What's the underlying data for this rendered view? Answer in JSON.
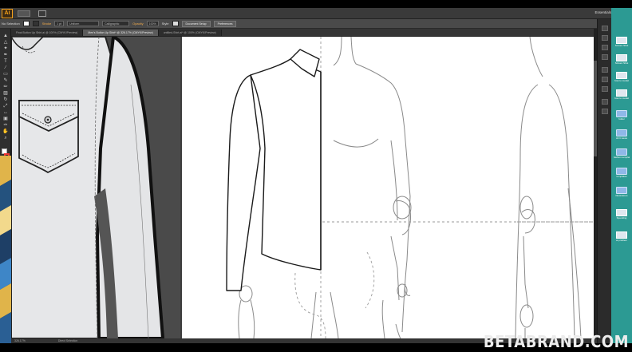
{
  "app": {
    "logo": "Ai",
    "workspace": "Essentials"
  },
  "control_bar": {
    "selection_label": "No Selection",
    "stroke_label": "Stroke",
    "stroke_value": "1 pt",
    "uniform_label": "Uniform",
    "brush_value": "Calligraphic",
    "opacity_label": "Opacity",
    "opacity_value": "100%",
    "style_label": "Style",
    "doc_setup_button": "Document Setup",
    "preferences_button": "Preferences"
  },
  "document": {
    "title": "Men's Button Up Shirt* @ 326.17% (CMYK/Preview)",
    "tabs": [
      {
        "label": "Final Button Up Shirt.ai @ 100% (CMYK/Preview)",
        "active": false
      },
      {
        "label": "Men's Button Up Shirt* @ 326.17% (CMYK/Preview)",
        "active": true
      },
      {
        "label": "untitled-Shirt.ai* @ 100% (CMYK/Preview)",
        "active": false
      }
    ]
  },
  "status": {
    "zoom": "326.17%",
    "tool": "Direct Selection"
  },
  "desktop_icons": [
    {
      "label": "Screen Shot",
      "type": "image"
    },
    {
      "label": "Screen Shot",
      "type": "image"
    },
    {
      "label": "how to model",
      "type": "image"
    },
    {
      "label": "how to model",
      "type": "image"
    },
    {
      "label": "folder",
      "type": "folder"
    },
    {
      "label": "shirt views",
      "type": "folder"
    },
    {
      "label": "fashion templates",
      "type": "folder"
    },
    {
      "label": "templates",
      "type": "folder"
    },
    {
      "label": "illustrations",
      "type": "folder"
    },
    {
      "label": "Spending",
      "type": "image"
    },
    {
      "label": "ai problem",
      "type": "image"
    }
  ],
  "watermark": "BETABRAND.COM",
  "colors": {
    "desktop": "#2c9a93",
    "accent": "#f7a21b",
    "stroke_swatch": "#e33333"
  }
}
